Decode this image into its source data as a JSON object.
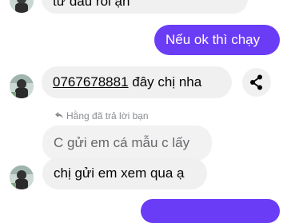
{
  "messages": {
    "top_partial_in": "từ đầu rồi ạn",
    "out_1": "Nếu ok thì chạy",
    "in_phone": "0767678881",
    "in_phone_suffix": " đây chị nha",
    "reply_label": "Hằng đã trả lời bạn",
    "quoted_text": "C gửi em cá mẫu c lấy",
    "in_last": "chị gửi em xem qua ạ"
  },
  "icons": {
    "share": "share-icon",
    "reply": "reply-arrow-icon",
    "avatar": "avatar"
  },
  "colors": {
    "outgoing_bubble": "#6b3cf6",
    "incoming_bubble": "#f0f0f0",
    "reply_label": "#8a8d91"
  }
}
